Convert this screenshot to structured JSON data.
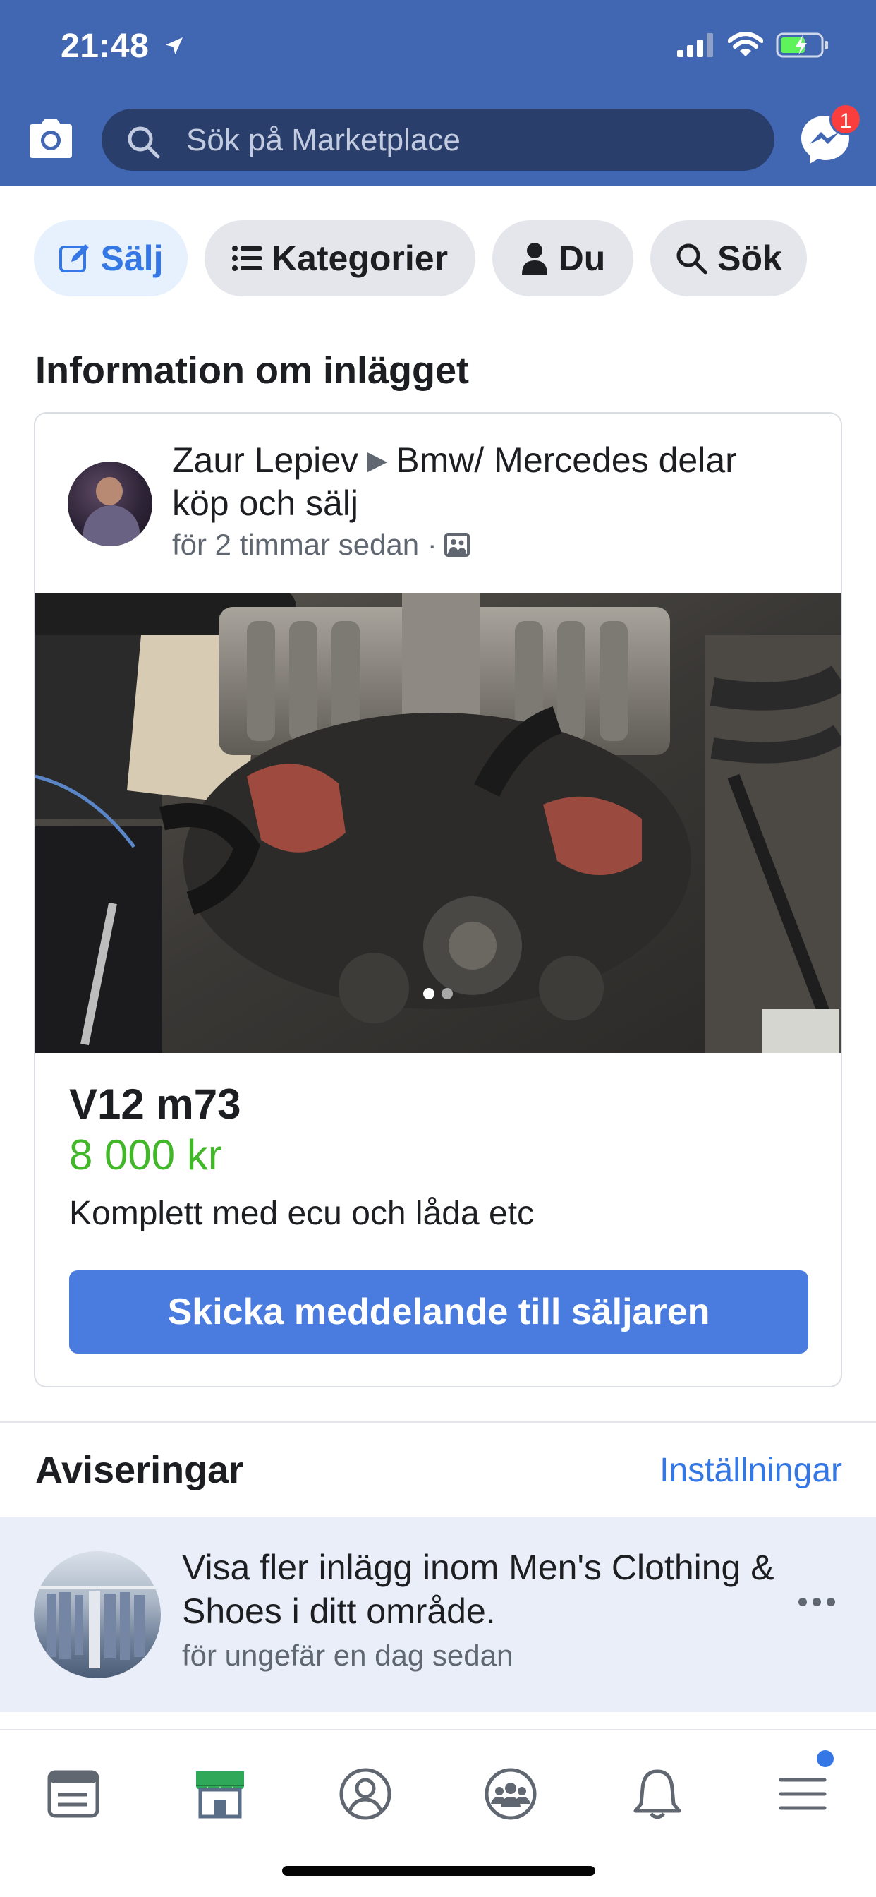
{
  "status_bar": {
    "time": "21:48"
  },
  "search": {
    "placeholder": "Sök på Marketplace"
  },
  "messenger": {
    "badge": "1"
  },
  "pills": [
    {
      "label": "Sälj",
      "icon": "edit-icon"
    },
    {
      "label": "Kategorier",
      "icon": "list-icon"
    },
    {
      "label": "Du",
      "icon": "person-icon"
    },
    {
      "label": "Sök",
      "icon": "search-icon"
    }
  ],
  "section_title": "Information om inlägget",
  "post": {
    "author": "Zaur Lepiev",
    "group": "Bmw/ Mercedes delar köp och sälj",
    "time": "för 2 timmar sedan ·",
    "title": "V12 m73",
    "price": "8 000 kr",
    "description": "Komplett med ecu och låda etc",
    "cta": "Skicka meddelande till säljaren",
    "photo_count": 2,
    "photo_index": 1
  },
  "notifications": {
    "title": "Aviseringar",
    "settings_link": "Inställningar",
    "items": [
      {
        "text": "Visa fler inlägg inom Men's Clothing & Shoes i ditt område.",
        "time": "för ungefär en dag sedan"
      }
    ]
  },
  "bottom_nav": [
    "news-feed-icon",
    "marketplace-icon",
    "profile-icon",
    "groups-icon",
    "notifications-icon",
    "menu-icon"
  ],
  "colors": {
    "header": "#4267b2",
    "accent": "#3578e5",
    "price": "#42b72a",
    "cta": "#4a7ce0"
  }
}
